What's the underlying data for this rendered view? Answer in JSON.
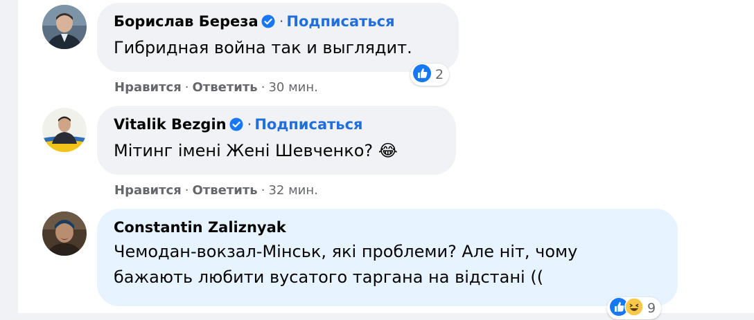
{
  "comments": [
    {
      "author": "Борислав Береза",
      "verified": true,
      "follow_label": "Подписаться",
      "text": "Гибридная война так и выглядит.",
      "like_label": "Нравится",
      "reply_label": "Ответить",
      "time": "30 мин.",
      "reactions": {
        "icons": [
          "like-icon"
        ],
        "count": "2"
      }
    },
    {
      "author": "Vitalik Bezgin",
      "verified": true,
      "follow_label": "Подписаться",
      "text": "Мітинг імені Жені Шевченко?",
      "emoji": "😂",
      "like_label": "Нравится",
      "reply_label": "Ответить",
      "time": "32 мин."
    },
    {
      "author": "Constantin Zaliznyak",
      "verified": false,
      "text_line1": "Чемодан-вокзал-Мінськ, які проблеми? Але ніт, чому",
      "text_line2": "бажають любити вусатого таргана на відстані ((",
      "reactions": {
        "icons": [
          "like-icon",
          "haha-icon"
        ],
        "count": "9"
      }
    }
  ],
  "colors": {
    "accent": "#216fdb",
    "bubble": "#f0f2f5",
    "bubble_highlight": "#e7f3ff",
    "secondary_text": "#65676b"
  },
  "separator": "·"
}
